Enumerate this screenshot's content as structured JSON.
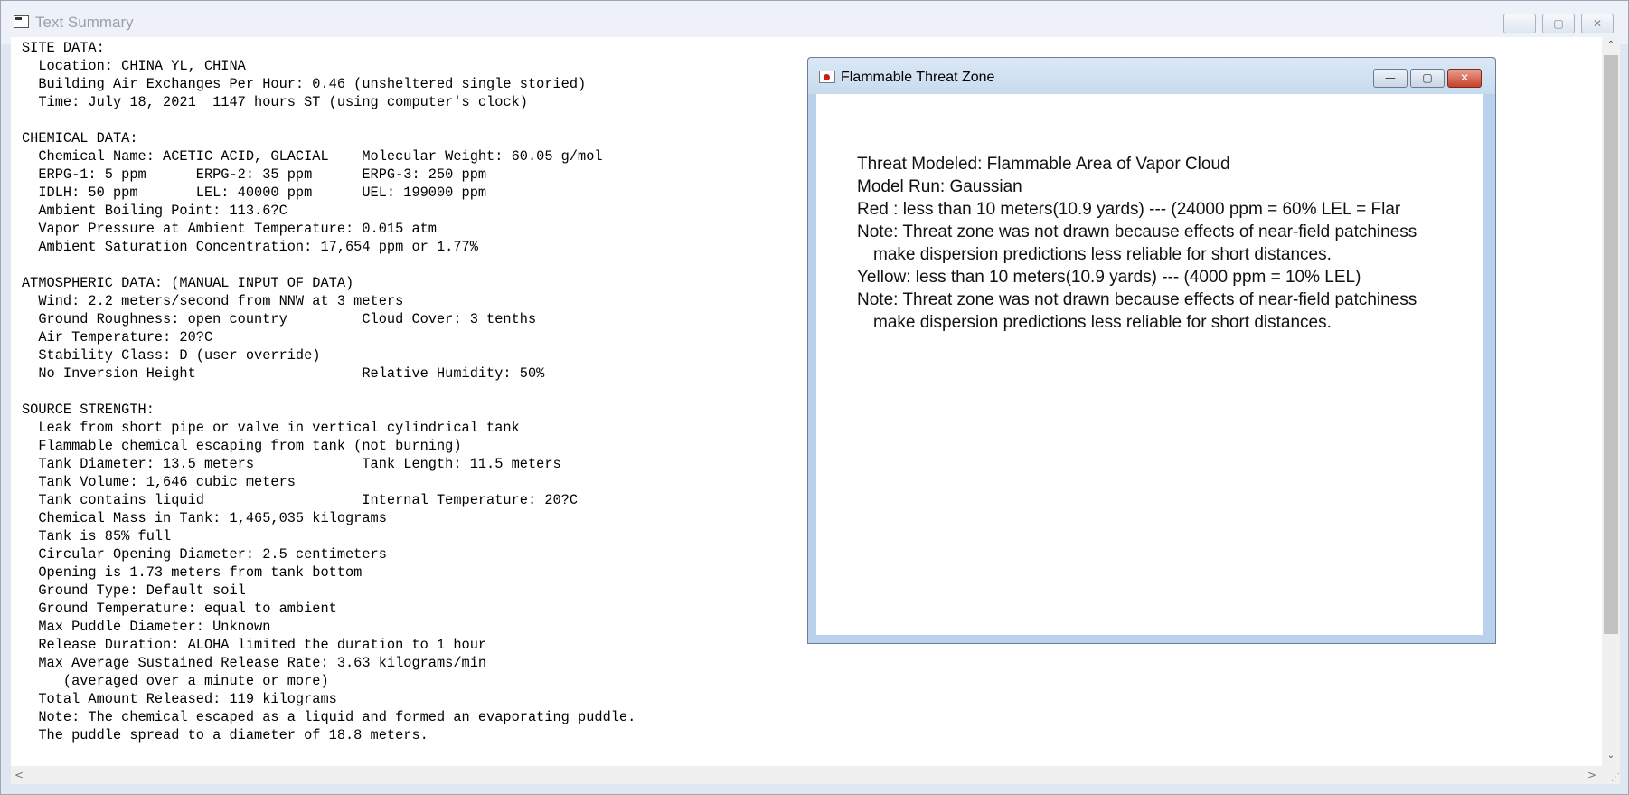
{
  "main_window": {
    "title": "Text Summary",
    "controls": {
      "minimize": "—",
      "maximize": "▢",
      "close": "✕"
    }
  },
  "report_lines": [
    "SITE DATA:",
    "  Location: CHINA YL, CHINA",
    "  Building Air Exchanges Per Hour: 0.46 (unsheltered single storied)",
    "  Time: July 18, 2021  1147 hours ST (using computer's clock)",
    "",
    "CHEMICAL DATA:",
    "  Chemical Name: ACETIC ACID, GLACIAL    Molecular Weight: 60.05 g/mol",
    "  ERPG-1: 5 ppm      ERPG-2: 35 ppm      ERPG-3: 250 ppm",
    "  IDLH: 50 ppm       LEL: 40000 ppm      UEL: 199000 ppm",
    "  Ambient Boiling Point: 113.6?C",
    "  Vapor Pressure at Ambient Temperature: 0.015 atm",
    "  Ambient Saturation Concentration: 17,654 ppm or 1.77%",
    "",
    "ATMOSPHERIC DATA: (MANUAL INPUT OF DATA)",
    "  Wind: 2.2 meters/second from NNW at 3 meters",
    "  Ground Roughness: open country         Cloud Cover: 3 tenths",
    "  Air Temperature: 20?C",
    "  Stability Class: D (user override)",
    "  No Inversion Height                    Relative Humidity: 50%",
    "",
    "SOURCE STRENGTH:",
    "  Leak from short pipe or valve in vertical cylindrical tank",
    "  Flammable chemical escaping from tank (not burning)",
    "  Tank Diameter: 13.5 meters             Tank Length: 11.5 meters",
    "  Tank Volume: 1,646 cubic meters",
    "  Tank contains liquid                   Internal Temperature: 20?C",
    "  Chemical Mass in Tank: 1,465,035 kilograms",
    "  Tank is 85% full",
    "  Circular Opening Diameter: 2.5 centimeters",
    "  Opening is 1.73 meters from tank bottom",
    "  Ground Type: Default soil",
    "  Ground Temperature: equal to ambient",
    "  Max Puddle Diameter: Unknown",
    "  Release Duration: ALOHA limited the duration to 1 hour",
    "  Max Average Sustained Release Rate: 3.63 kilograms/min",
    "     (averaged over a minute or more)",
    "  Total Amount Released: 119 kilograms",
    "  Note: The chemical escaped as a liquid and formed an evaporating puddle.",
    "  The puddle spread to a diameter of 18.8 meters."
  ],
  "dialog": {
    "title": "Flammable Threat Zone",
    "controls": {
      "minimize": "—",
      "maximize": "▢",
      "close": "✕"
    },
    "lines": {
      "threat": "Threat Modeled: Flammable Area of Vapor Cloud",
      "model": "Model Run: Gaussian",
      "red": "Red   : less than 10 meters(10.9 yards) --- (24000 ppm = 60% LEL = Flar",
      "note1": "Note: Threat zone was not drawn because effects of near-field patchiness",
      "note1b": "make dispersion predictions less reliable for short distances.",
      "yellow": "Yellow: less than 10 meters(10.9 yards) --- (4000 ppm = 10% LEL)",
      "note2": "Note: Threat zone was not drawn because effects of near-field patchiness",
      "note2b": "make dispersion predictions less reliable for short distances."
    }
  },
  "scrollbars": {
    "up": "⌃",
    "down": "⌄",
    "left": "<",
    "right": ">"
  }
}
